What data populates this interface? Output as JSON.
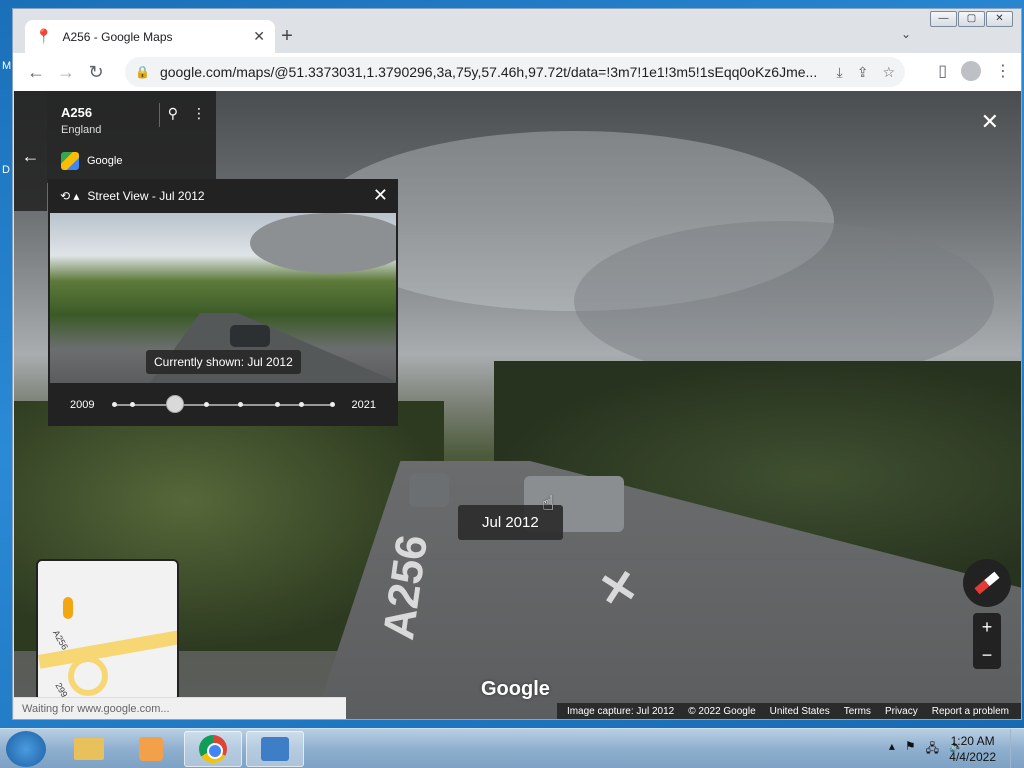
{
  "desktop": {
    "stray_left_top": "M",
    "stray_left_mid": "D"
  },
  "browser": {
    "tab_title": "A256 - Google Maps",
    "tab_close": "✕",
    "new_tab": "+",
    "tab_dropdown": "⌄",
    "url": "google.com/maps/@51.3373031,1.3790296,3a,75y,57.46h,97.72t/data=!3m7!1e1!3m5!1sEqq0oKz6Jme...",
    "window_controls": {
      "minimize": "—",
      "maximize": "▢",
      "close": "✕"
    }
  },
  "place": {
    "name": "A256",
    "region": "England",
    "source": "Google"
  },
  "timemachine": {
    "title": "Street View - Jul 2012",
    "tooltip": "Currently shown: Jul 2012",
    "start_year": "2009",
    "end_year": "2021",
    "selected_fraction": 0.28,
    "dot_fractions": [
      0.0,
      0.08,
      0.42,
      0.58,
      0.75,
      0.86,
      1.0
    ]
  },
  "viewport": {
    "date_tooltip": "Jul 2012",
    "road_marking": "A256",
    "watermark": "Google",
    "status": "Waiting for www.google.com...",
    "minimap_labels": {
      "road": "A256",
      "road2": "299"
    }
  },
  "footer": {
    "capture": "Image capture: Jul 2012",
    "copyright": "© 2022 Google",
    "country": "United States",
    "terms": "Terms",
    "privacy": "Privacy",
    "report": "Report a problem"
  },
  "zoom": {
    "in": "+",
    "out": "−"
  },
  "taskbar": {
    "time": "1:20 AM",
    "date": "4/4/2022"
  }
}
